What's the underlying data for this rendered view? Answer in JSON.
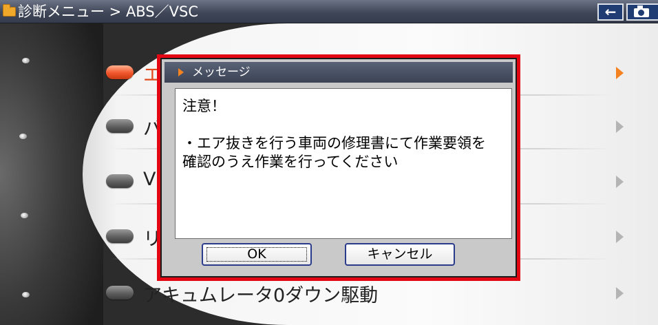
{
  "header": {
    "breadcrumb": "診断メニュー > ABS／VSC",
    "back_icon": "←",
    "folder_icon": "folder-icon",
    "camera_icon": "camera-icon"
  },
  "menu": {
    "items": [
      {
        "label": "エア抜き",
        "active": true
      },
      {
        "label": "バ",
        "active": false
      },
      {
        "label": "V",
        "active": false
      },
      {
        "label": "リ",
        "active": false
      },
      {
        "label": "アキュムレータ0ダウン駆動",
        "active": false
      }
    ]
  },
  "dialog": {
    "title": "メッセージ",
    "body": {
      "line1": "注意！",
      "line2": "",
      "line3": "・エア抜きを行う車両の修理書にて作業要領を",
      "line4": "確認のうえ作業を行ってください"
    },
    "ok_label": "OK",
    "cancel_label": "キャンセル"
  },
  "colors": {
    "highlight": "#e30613",
    "active_item": "#f2562c",
    "title_bar": "#3f4758"
  }
}
